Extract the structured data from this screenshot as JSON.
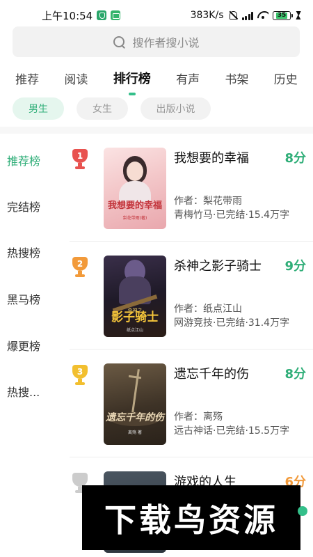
{
  "status_bar": {
    "time": "上午10:54",
    "network_speed": "383K/s",
    "battery": "35"
  },
  "search": {
    "placeholder": "搜作者搜小说"
  },
  "tabs": [
    {
      "label": "推荐"
    },
    {
      "label": "阅读"
    },
    {
      "label": "排行榜",
      "active": true
    },
    {
      "label": "有声"
    },
    {
      "label": "书架"
    },
    {
      "label": "历史"
    }
  ],
  "chips": [
    {
      "label": "男生",
      "active": true
    },
    {
      "label": "女生"
    },
    {
      "label": "出版小说"
    }
  ],
  "sidebar": [
    {
      "label": "推荐榜",
      "active": true
    },
    {
      "label": "完结榜"
    },
    {
      "label": "热搜榜"
    },
    {
      "label": "黑马榜"
    },
    {
      "label": "爆更榜"
    },
    {
      "label": "热搜..."
    }
  ],
  "books": [
    {
      "rank": "1",
      "title": "我想要的幸福",
      "score": "8分",
      "author": "作者：梨花带雨",
      "meta": "青梅竹马·已完结·15.4万字",
      "cover_text": "我想要的幸福",
      "cover_sub": "梨花带雨(著)"
    },
    {
      "rank": "2",
      "title": "杀神之影子骑士",
      "score": "9分",
      "author": "作者：纸点江山",
      "meta": "网游竞技·已完结·31.4万字",
      "cover_text": "影子骑士",
      "cover_top": "杀神之",
      "cover_sub": "纸点江山"
    },
    {
      "rank": "3",
      "title": "遗忘千年的伤",
      "score": "8分",
      "author": "作者：离殇",
      "meta": "远古神话·已完结·15.5万字",
      "cover_text": "遗忘千年的伤",
      "cover_sub": "离殇 著"
    },
    {
      "rank": "",
      "title": "游戏的人生",
      "score": "6分"
    }
  ],
  "watermark": "下载鸟资源",
  "colors": {
    "accent": "#2fae78",
    "rank1": "#e8524f",
    "rank2": "#f29a3a",
    "rank3": "#f2bf2f",
    "rank4": "#cccccc"
  }
}
